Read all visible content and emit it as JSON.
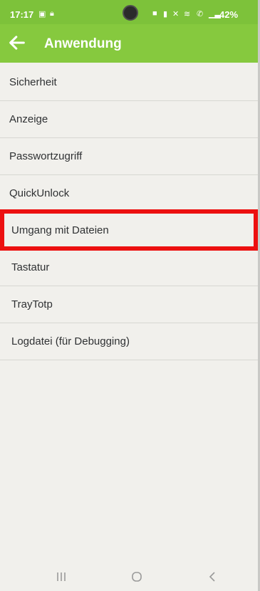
{
  "status_bar": {
    "time": "17:17",
    "battery": "42%"
  },
  "header": {
    "title": "Anwendung"
  },
  "menu": {
    "items": [
      {
        "label": "Sicherheit"
      },
      {
        "label": "Anzeige"
      },
      {
        "label": "Passwortzugriff"
      },
      {
        "label": "QuickUnlock"
      },
      {
        "label": "Umgang mit Dateien",
        "highlighted": true
      },
      {
        "label": "Tastatur"
      },
      {
        "label": "TrayTotp"
      },
      {
        "label": "Logdatei (für Debugging)"
      }
    ]
  },
  "colors": {
    "app_bar": "#86c93e",
    "highlight": "#ec1010"
  },
  "nav": {
    "icons": [
      "recent-apps-icon",
      "home-icon",
      "back-nav-icon"
    ]
  }
}
